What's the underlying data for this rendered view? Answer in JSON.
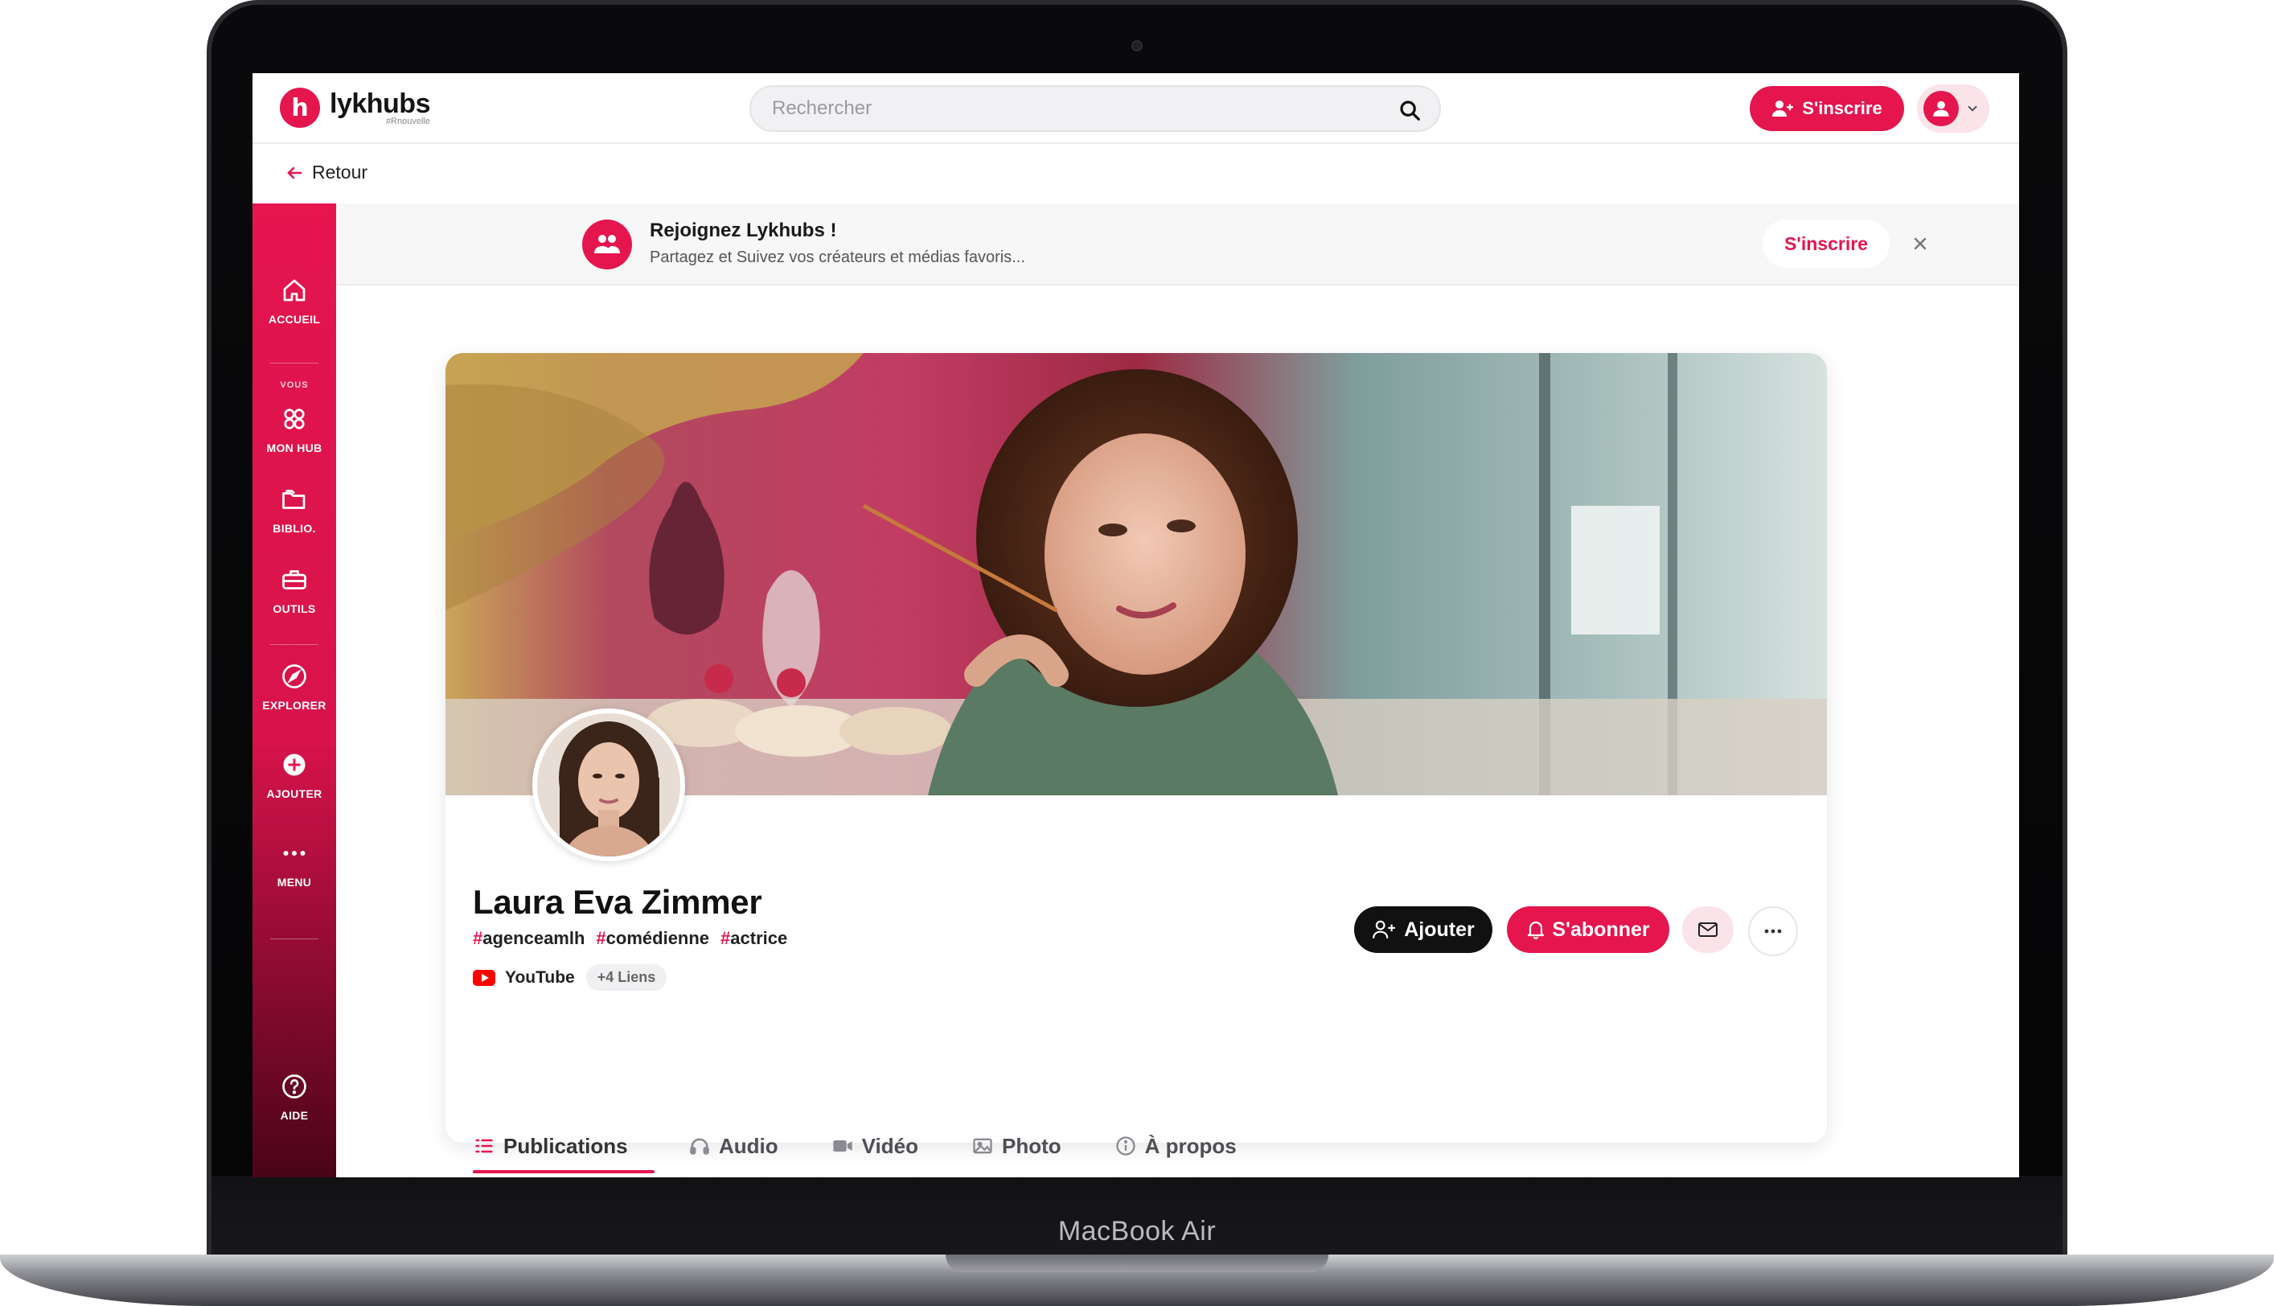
{
  "device": {
    "label": "MacBook Air"
  },
  "header": {
    "logo_name": "lykhubs",
    "logo_tag": "#Rnouvelle",
    "search_placeholder": "Rechercher",
    "signup_label": "S'inscrire"
  },
  "back": {
    "label": "Retour"
  },
  "sidebar": {
    "items": [
      {
        "label": "ACCUEIL",
        "icon": "home-icon"
      },
      {
        "label": "MON HUB",
        "icon": "hub-icon"
      },
      {
        "label": "BIBLIO.",
        "icon": "folder-icon"
      },
      {
        "label": "OUTILS",
        "icon": "toolbox-icon"
      },
      {
        "label": "EXPLORER",
        "icon": "compass-icon"
      },
      {
        "label": "AJOUTER",
        "icon": "plus-circle-icon"
      },
      {
        "label": "MENU",
        "icon": "dots-icon"
      },
      {
        "label": "AIDE",
        "icon": "help-icon"
      }
    ],
    "section_you": "VOUS"
  },
  "banner": {
    "title": "Rejoignez Lykhubs !",
    "subtitle": "Partagez et Suivez vos créateurs et médias favoris...",
    "signup_label": "S'inscrire"
  },
  "profile": {
    "name": "Laura Eva Zimmer",
    "tags": [
      "agenceamlh",
      "comédienne",
      "actrice"
    ],
    "youtube_label": "YouTube",
    "more_links": "+4 Liens",
    "add_label": "Ajouter",
    "subscribe_label": "S'abonner"
  },
  "tabs": [
    {
      "label": "Publications",
      "icon": "list-icon",
      "active": true
    },
    {
      "label": "Audio",
      "icon": "headphones-icon",
      "active": false
    },
    {
      "label": "Vidéo",
      "icon": "video-icon",
      "active": false
    },
    {
      "label": "Photo",
      "icon": "image-icon",
      "active": false
    },
    {
      "label": "À propos",
      "icon": "info-icon",
      "active": false
    }
  ],
  "colors": {
    "brand": "#e5154e",
    "dark": "#111111"
  }
}
